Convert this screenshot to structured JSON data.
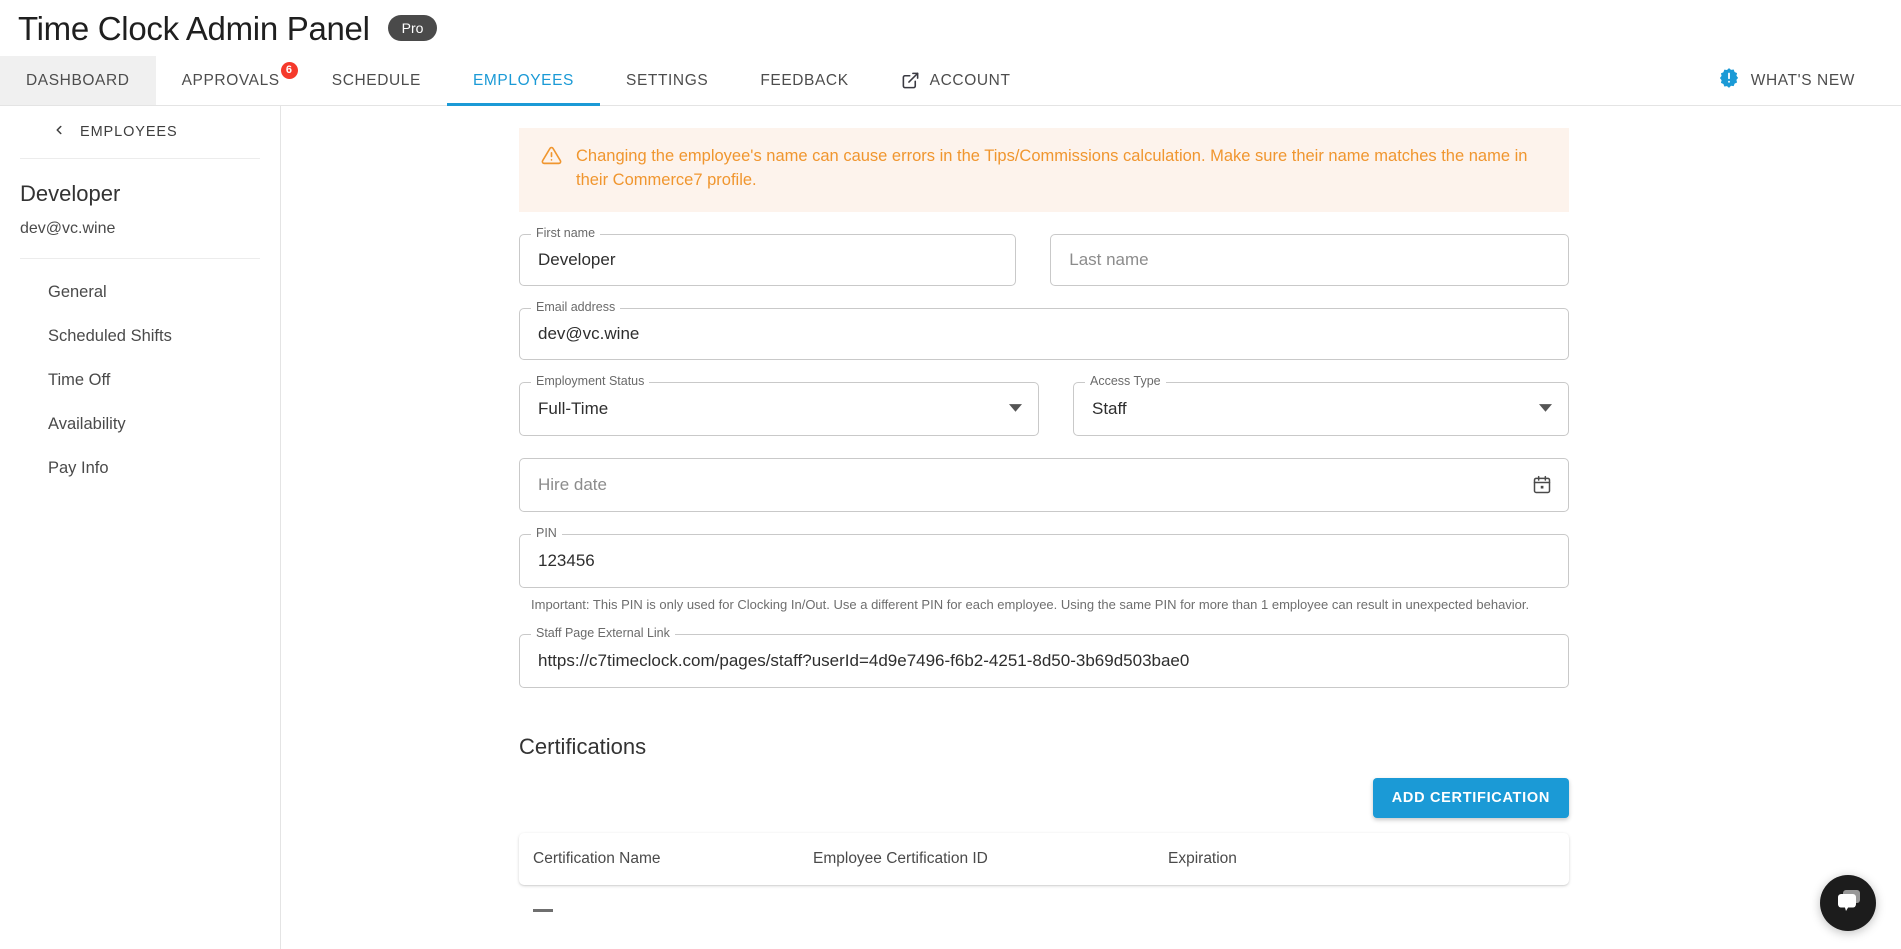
{
  "header": {
    "title": "Time Clock Admin Panel",
    "plan_badge": "Pro"
  },
  "tabs": [
    {
      "label": "DASHBOARD",
      "state": "hovered",
      "badge": null,
      "icon": null
    },
    {
      "label": "APPROVALS",
      "state": "normal",
      "badge": "6",
      "icon": null
    },
    {
      "label": "SCHEDULE",
      "state": "normal",
      "badge": null,
      "icon": null
    },
    {
      "label": "EMPLOYEES",
      "state": "active",
      "badge": null,
      "icon": null
    },
    {
      "label": "SETTINGS",
      "state": "normal",
      "badge": null,
      "icon": null
    },
    {
      "label": "FEEDBACK",
      "state": "normal",
      "badge": null,
      "icon": null
    },
    {
      "label": "ACCOUNT",
      "state": "normal",
      "badge": null,
      "icon": "external-link-icon"
    }
  ],
  "whats_new": {
    "label": "WHAT'S NEW",
    "icon": "announcement-badge-icon"
  },
  "sidebar": {
    "back_label": "EMPLOYEES",
    "back_icon": "chevron-left-icon",
    "employee_name": "Developer",
    "employee_email": "dev@vc.wine",
    "items": [
      {
        "label": "General"
      },
      {
        "label": "Scheduled Shifts"
      },
      {
        "label": "Time Off"
      },
      {
        "label": "Availability"
      },
      {
        "label": "Pay Info"
      }
    ]
  },
  "main": {
    "warning": {
      "icon": "warning-triangle-icon",
      "text": "Changing the employee's name can cause errors in the Tips/Commissions calculation. Make sure their name matches the name in their Commerce7 profile."
    },
    "fields": {
      "first_name": {
        "label": "First name",
        "value": "Developer",
        "placeholder": ""
      },
      "last_name": {
        "label": "",
        "value": "",
        "placeholder": "Last name"
      },
      "email": {
        "label": "Email address",
        "value": "dev@vc.wine",
        "placeholder": ""
      },
      "employment_status": {
        "label": "Employment Status",
        "value": "Full-Time",
        "icon": "chevron-down-icon"
      },
      "access_type": {
        "label": "Access Type",
        "value": "Staff",
        "icon": "chevron-down-icon"
      },
      "hire_date": {
        "label": "",
        "value": "",
        "placeholder": "Hire date",
        "icon": "calendar-icon"
      },
      "pin": {
        "label": "PIN",
        "value": "123456",
        "helper": "Important: This PIN is only used for Clocking In/Out. Use a different PIN for each employee. Using the same PIN for more than 1 employee can result in unexpected behavior."
      },
      "staff_link": {
        "label": "Staff Page External Link",
        "value": "https://c7timeclock.com/pages/staff?userId=4d9e7496-f6b2-4251-8d50-3b69d503bae0"
      }
    },
    "certifications": {
      "title": "Certifications",
      "add_button": "ADD CERTIFICATION",
      "columns": [
        "Certification Name",
        "Employee Certification ID",
        "Expiration"
      ],
      "rows": []
    }
  },
  "chat_widget": {
    "icon": "chat-bubbles-icon"
  },
  "colors": {
    "accent": "#1b9ad6",
    "warning_text": "#f0962f",
    "warning_bg": "#fdf3ec",
    "badge_red": "#f5392b",
    "pro_badge_bg": "#4a4a4a",
    "chat_bg": "#1c1c1c"
  }
}
